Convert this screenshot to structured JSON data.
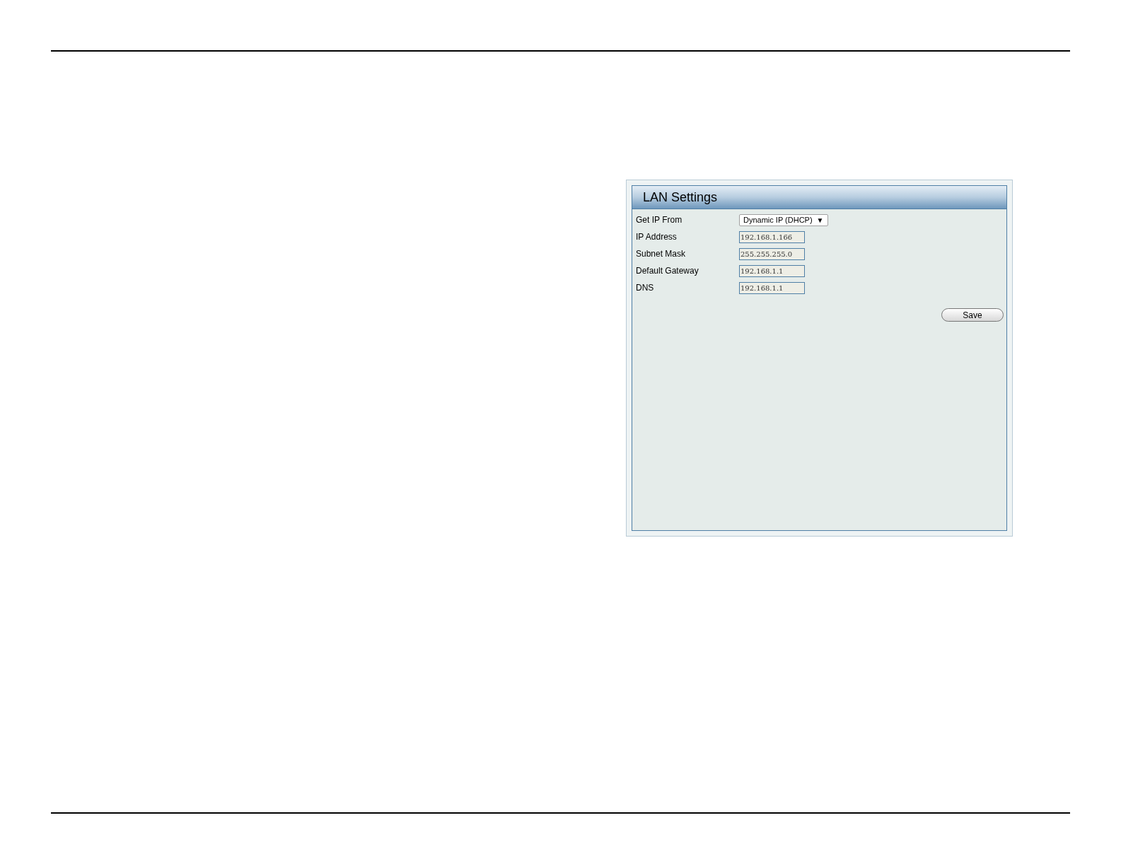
{
  "panel": {
    "title": "LAN Settings",
    "fields": [
      {
        "kind": "select",
        "label": "Get IP From",
        "value": "Dynamic IP (DHCP)",
        "arrow": "▼"
      },
      {
        "kind": "text",
        "label": "IP Address",
        "value": "192.168.1.166"
      },
      {
        "kind": "text",
        "label": "Subnet Mask",
        "value": "255.255.255.0"
      },
      {
        "kind": "text",
        "label": "Default Gateway",
        "value": "192.168.1.1"
      },
      {
        "kind": "text",
        "label": "DNS",
        "value": "192.168.1.1"
      }
    ],
    "save_button": "Save"
  }
}
